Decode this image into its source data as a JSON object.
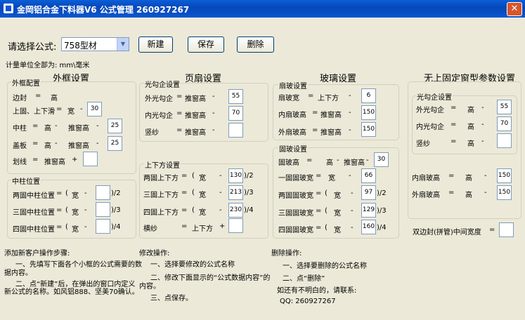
{
  "window": {
    "title": "金岡铝合金下料器V6  公式管理     260927267",
    "close_glyph": "✕"
  },
  "toolbar": {
    "formula_label": "请选择公式:",
    "formula_value": "758型材",
    "new_label": "新建",
    "save_label": "保存",
    "delete_label": "删除"
  },
  "unit_note": "计量单位全部为: mm\\毫米",
  "sections": {
    "outer": "外框设置",
    "sash": "页扇设置",
    "glass": "玻璃设置",
    "fixed": "无上固定窗型参数设置"
  },
  "outer": {
    "group1": "外框配置",
    "biancfeng": "边封",
    "eq": "=",
    "gao": "高",
    "shangxia": "上固、上下滑",
    "kuan": "宽",
    "minus": "-",
    "v_shangxia": "30",
    "zhongzhu": "中柱",
    "tuichuanggao": "推窗高",
    "v_zhongzhu": "25",
    "gaiban": "盖板",
    "v_gaiban": "25",
    "huaxian": "划线",
    "plus": "+",
    "group2": "中柱位置",
    "liang": "两固中柱位置",
    "san": "三固中柱位置",
    "si": "四固中柱位置",
    "lp": "(",
    "d2": ")/2",
    "d3": ")/3",
    "d4": ")/4"
  },
  "sash": {
    "group1": "光勾企设置",
    "waiguang": "外光勾企",
    "tuichuanggao": "推窗高",
    "v_wai": "55",
    "neiguang": "内光勾企",
    "v_nei": "70",
    "shasha": "竖纱",
    "group2": "上下方设置",
    "liang": "两固上下方",
    "v_liang": "130",
    "san": "三固上下方",
    "v_san": "213",
    "si": "四固上下方",
    "v_si": "230",
    "hengsha": "横纱",
    "shangxiafang": "上下方"
  },
  "glass": {
    "group1": "扇玻设置",
    "shanbokuan": "扇玻宽",
    "shangxiafang": "上下方",
    "v_shanbokuan": "6",
    "neishanbogao": "内扇玻高",
    "tuichuanggao": "推窗高",
    "v_nei": "150",
    "waishanbogao": "外扇玻高",
    "v_wai": "150",
    "group2": "固玻设置",
    "gubogao": "固玻高",
    "gao": "高",
    "v_gubogao": "30",
    "yigu": "一固固玻宽",
    "kuan": "宽",
    "v_yigu": "66",
    "lianggu": "两固固玻宽",
    "v_lianggu": "97",
    "sangu": "三固固玻宽",
    "v_sangu": "129",
    "sigu": "四固固玻宽",
    "v_sigu": "160"
  },
  "fixed": {
    "group1": "光勾企设置",
    "waiguang": "外光勾企",
    "gao": "高",
    "v_wai": "55",
    "neiguang": "内光勾企",
    "v_nei": "70",
    "shasha": "竖纱",
    "neishanbogao": "内扇玻高",
    "v_neishan": "150",
    "waishanbogao": "外扇玻高",
    "v_waishan": "150",
    "shuangbian": "双边封(拼管)中间宽度"
  },
  "help": {
    "add": [
      "添加新客户操作步骤:",
      "一、先填写下面各个小框的公式需要的数",
      "据内容。",
      "二、点“新建”后，在弹出的窗口内定义",
      "新公式的名称。如风铝888、坚美70确认。"
    ],
    "edit": [
      "修改操作:",
      "一、选择要修改的公式名称",
      "二、修改下面显示的“公式数据内容”的",
      "内容。",
      "三、点保存。"
    ],
    "del": [
      "删除操作:",
      "一、选择要删除的公式名称",
      "二、点“删除”",
      "如还有不明白的，请联系:",
      "QQ: 260927267"
    ]
  }
}
